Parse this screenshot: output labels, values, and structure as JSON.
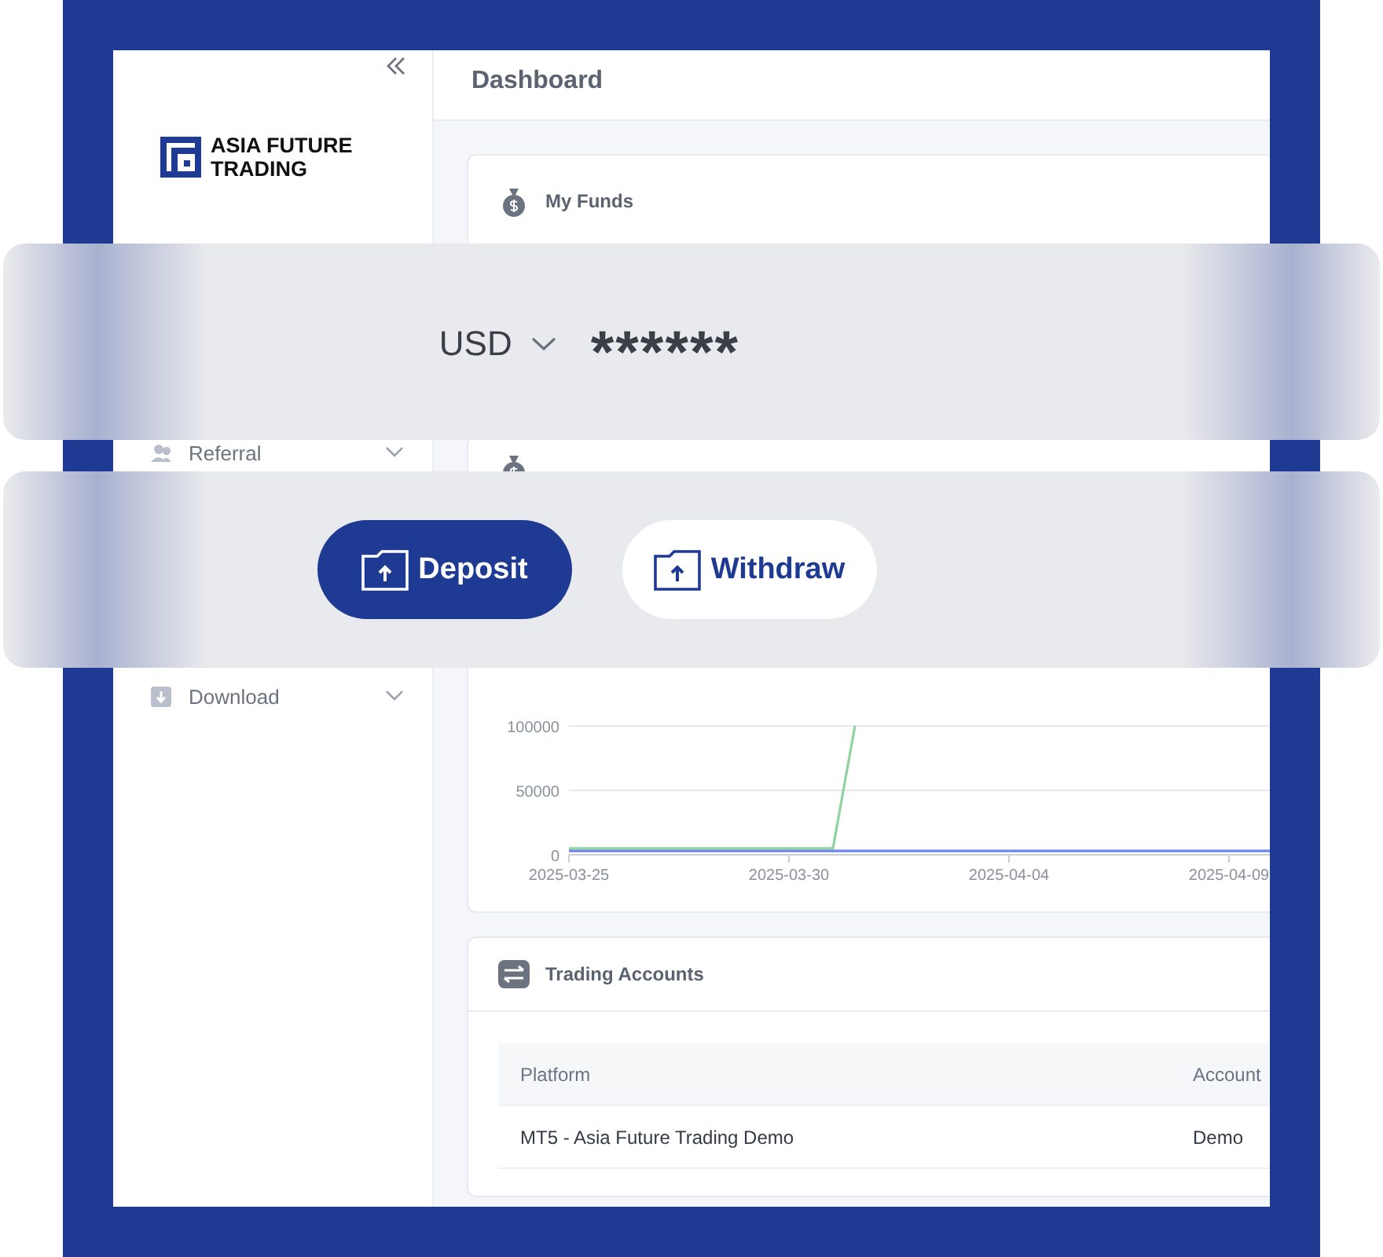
{
  "header": {
    "title": "Dashboard"
  },
  "sidebar": {
    "logo": {
      "lines": [
        "ASIA FUTURE",
        "TRADING"
      ]
    },
    "items": [
      {
        "kind": "menu",
        "label": "Referral"
      },
      {
        "kind": "menu",
        "label": "Download"
      }
    ]
  },
  "funds_card": {
    "title": "My Funds"
  },
  "balance": {
    "currency": "USD",
    "amount": "******"
  },
  "actions": [
    {
      "label": "Deposit",
      "primary": true
    },
    {
      "label": "Withdraw",
      "primary": false
    }
  ],
  "chart_card": {
    "chart_data": {
      "type": "line",
      "categories": [
        "2025-03-25",
        null,
        null,
        null,
        null,
        null,
        null,
        null,
        null,
        null,
        "2025-03-30",
        null,
        null,
        null,
        null,
        null,
        null,
        null,
        null,
        null,
        "2025-04-04",
        null,
        null,
        null,
        null,
        null,
        null,
        null,
        null,
        null,
        "2025-04-09",
        null,
        null
      ],
      "series": [
        {
          "color": "#8fd4a0",
          "values": [
            5000,
            5000,
            5000,
            5000,
            5000,
            5000,
            5000,
            5000,
            5000,
            5000,
            5000,
            5000,
            5000,
            100000,
            null,
            null,
            null,
            null,
            null,
            null,
            null,
            null,
            null,
            null,
            null,
            null,
            null,
            null,
            null,
            null,
            null,
            null,
            null
          ]
        },
        {
          "color": "#6f86f0",
          "values": [
            3000,
            3000,
            3000,
            3000,
            3000,
            3000,
            3000,
            3000,
            3000,
            3000,
            3000,
            3000,
            3000,
            3000,
            3000,
            3000,
            3000,
            3000,
            3000,
            3000,
            3000,
            3000,
            3000,
            3000,
            3000,
            3000,
            3000,
            3000,
            3000,
            3000,
            3000,
            3000,
            3000
          ]
        }
      ],
      "ylim": [
        0,
        100000
      ],
      "yticks": [
        0,
        50000,
        100000
      ]
    }
  },
  "accounts": {
    "title": "Trading Accounts",
    "columns": [
      "Platform",
      "Account"
    ],
    "rows": [
      [
        "MT5 - Asia Future Trading Demo",
        "Demo"
      ]
    ]
  }
}
